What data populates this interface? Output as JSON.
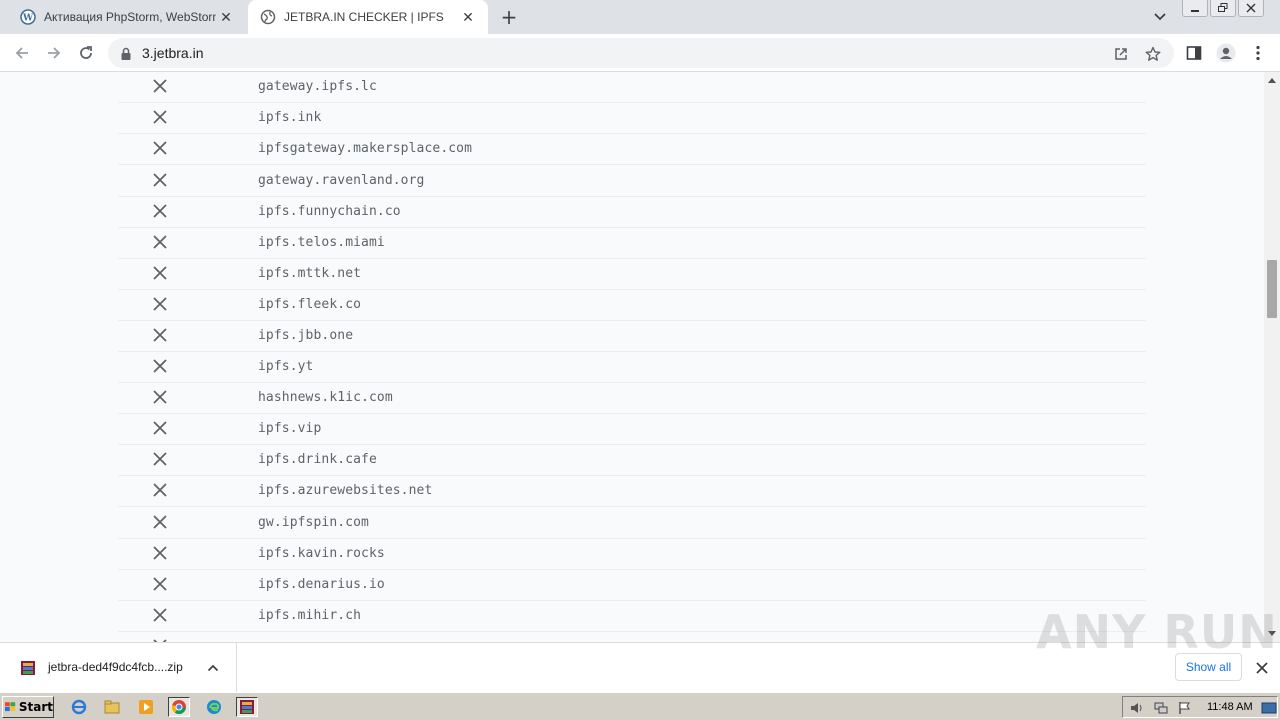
{
  "tabs": [
    {
      "title": "Активация PhpStorm, WebStorm, In",
      "active": false,
      "icon": "wordpress-icon"
    },
    {
      "title": "JETBRA.IN CHECKER | IPFS",
      "active": true,
      "icon": "globe-icon"
    }
  ],
  "address_bar": {
    "url": "3.jetbra.in"
  },
  "gateways": [
    "gateway.ipfs.lc",
    "ipfs.ink",
    "ipfsgateway.makersplace.com",
    "gateway.ravenland.org",
    "ipfs.funnychain.co",
    "ipfs.telos.miami",
    "ipfs.mttk.net",
    "ipfs.fleek.co",
    "ipfs.jbb.one",
    "ipfs.yt",
    "hashnews.k1ic.com",
    "ipfs.vip",
    "ipfs.drink.cafe",
    "ipfs.azurewebsites.net",
    "gw.ipfspin.com",
    "ipfs.kavin.rocks",
    "ipfs.denarius.io",
    "ipfs.mihir.ch"
  ],
  "gateway_status": "failed",
  "download_bar": {
    "filename": "jetbra-ded4f9dc4fcb....zip",
    "show_all": "Show all"
  },
  "watermark": "ANY RUN",
  "taskbar": {
    "start_label": "Start",
    "clock": "11:48 AM"
  },
  "colors": {
    "accent": "#1a73e8",
    "fail_x": "#5f6368",
    "content_bg": "#f8fafc"
  }
}
